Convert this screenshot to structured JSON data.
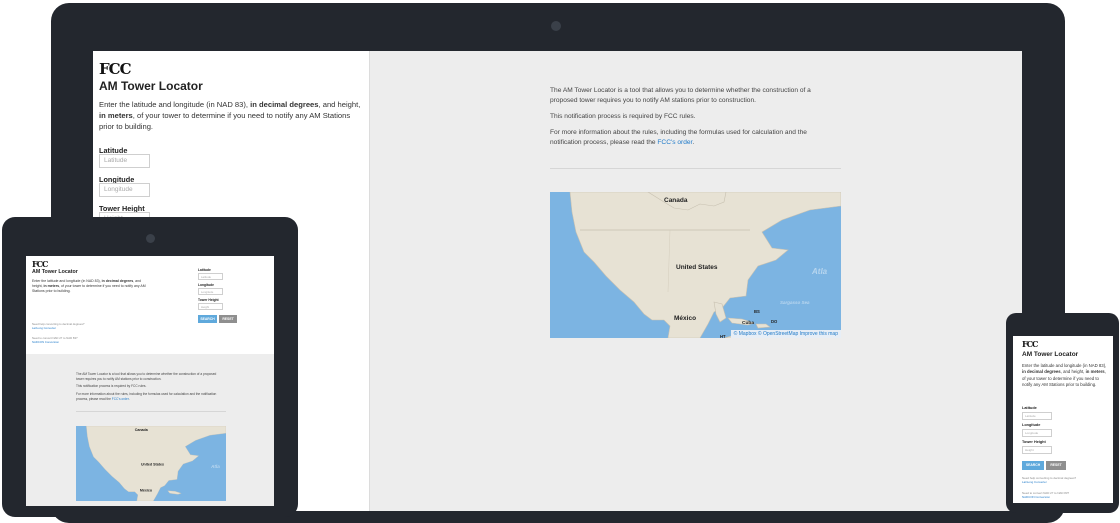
{
  "app": {
    "logo": "FCC",
    "title": "AM Tower Locator",
    "intro_1": "Enter the latitude and longitude (in NAD 83), ",
    "intro_bold_1": "in decimal degrees",
    "intro_2": ", and height, ",
    "intro_bold_2": "in meters",
    "intro_3": ", of your tower to determine if you need to notify any AM Stations prior to building."
  },
  "form": {
    "latitude_label": "Latitude",
    "latitude_placeholder": "Latitude",
    "longitude_label": "Longitude",
    "longitude_placeholder": "Longitude",
    "height_label": "Tower Height",
    "height_placeholder": "Height",
    "search_label": "SEARCH",
    "reset_label": "RESET"
  },
  "help": {
    "convert_question": "Need help converting to decimal degrees?",
    "convert_link": "Lat/Long Converter",
    "nad_question": "Need to convert NAD 27 to NAD 83?",
    "nad_link": "NADCON Conversion"
  },
  "info": {
    "para_1": "The AM Tower Locator is a tool that allows you to determine whether the construction of a proposed tower requires you to notify AM stations prior to construction.",
    "para_2": "This notification process is required by FCC rules.",
    "para_3": "For more information about the rules, including the formulas used for calculation and the notification process, please read the ",
    "link": "FCC's order",
    "para_3_end": "."
  },
  "map": {
    "label_canada": "Canada",
    "label_us": "United States",
    "label_mexico": "México",
    "label_cuba": "Cuba",
    "label_atlantic": "Atla",
    "label_sargasso": "Sargasso Sea",
    "label_bs": "BS",
    "label_do": "DO",
    "label_ht": "HT",
    "attribution": "© Mapbox © OpenStreetMap Improve this map",
    "ocean_color": "#7cb4e2",
    "land_color": "#e7e2d4"
  },
  "colors": {
    "device_frame": "#23272e",
    "link": "#1f7ac9",
    "search_button": "#5fa9dc",
    "reset_button": "#8f8f8f"
  }
}
